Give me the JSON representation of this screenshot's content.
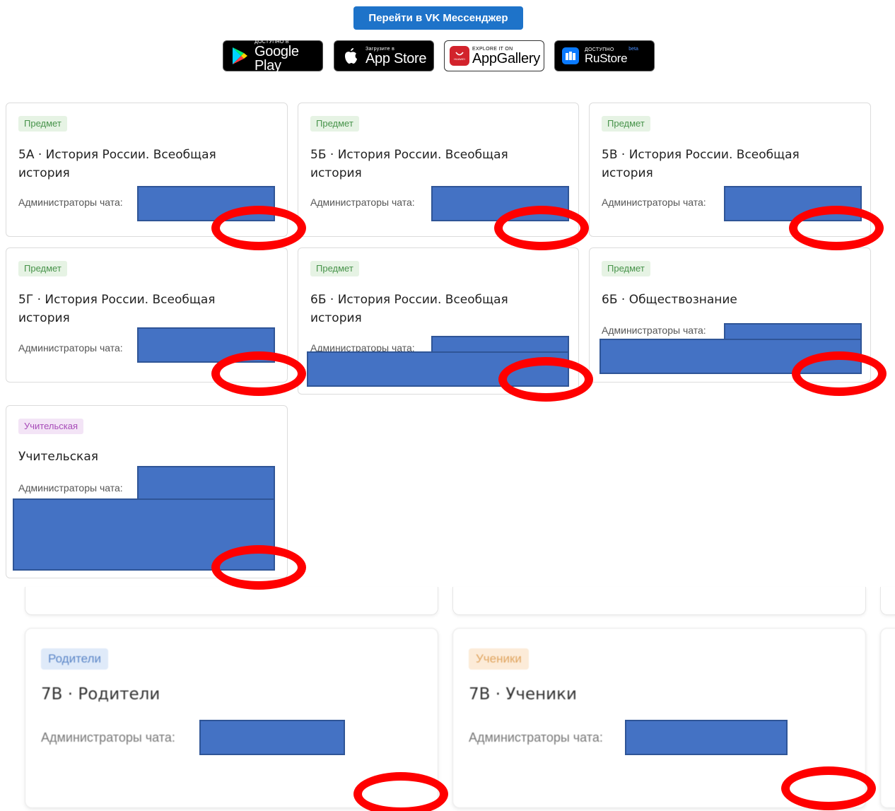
{
  "header": {
    "vk_button_label": "Перейти в VK Мессенджер"
  },
  "stores": [
    {
      "name": "google-play",
      "small": "ДОСТУПНО В",
      "big": "Google Play",
      "icon": "google-play-icon"
    },
    {
      "name": "app-store",
      "small": "Загрузите в",
      "big": "App Store",
      "icon": "apple-icon"
    },
    {
      "name": "app-gallery",
      "small": "EXPLORE IT ON",
      "big": "AppGallery",
      "icon": "huawei-icon",
      "sub": "HUAWEI"
    },
    {
      "name": "rustore",
      "small": "ДОСТУПНО",
      "big": "RuStore",
      "beta": "beta",
      "icon": "rustore-icon"
    }
  ],
  "admin_label": "Администраторы чата:",
  "cards": [
    {
      "tag": "Предмет",
      "title": "5А · История России. Всеобщая история"
    },
    {
      "tag": "Предмет",
      "title": "5Б · История России. Всеобщая история"
    },
    {
      "tag": "Предмет",
      "title": "5В · История России. Всеобщая история"
    },
    {
      "tag": "Предмет",
      "title": "5Г · История России. Всеобщая история"
    },
    {
      "tag": "Предмет",
      "title": "6Б · История России. Всеобщая история"
    },
    {
      "tag": "Предмет",
      "title": "6Б · Обществознание"
    },
    {
      "tag": "Учительская",
      "title": "Учительская"
    }
  ],
  "lower_cards": [
    {
      "tag": "Родители",
      "title": "7В · Родители",
      "admin": "Администраторы чата:"
    },
    {
      "tag": "Ученики",
      "title": "7В · Ученики",
      "admin": "Администраторы чата:"
    }
  ],
  "colors": {
    "vk_button": "#1e73c9",
    "subject_tag": "#47934a",
    "teacher_tag": "#a74bb8",
    "redaction": "#4472c4",
    "annotation_circle": "#ff0000"
  }
}
